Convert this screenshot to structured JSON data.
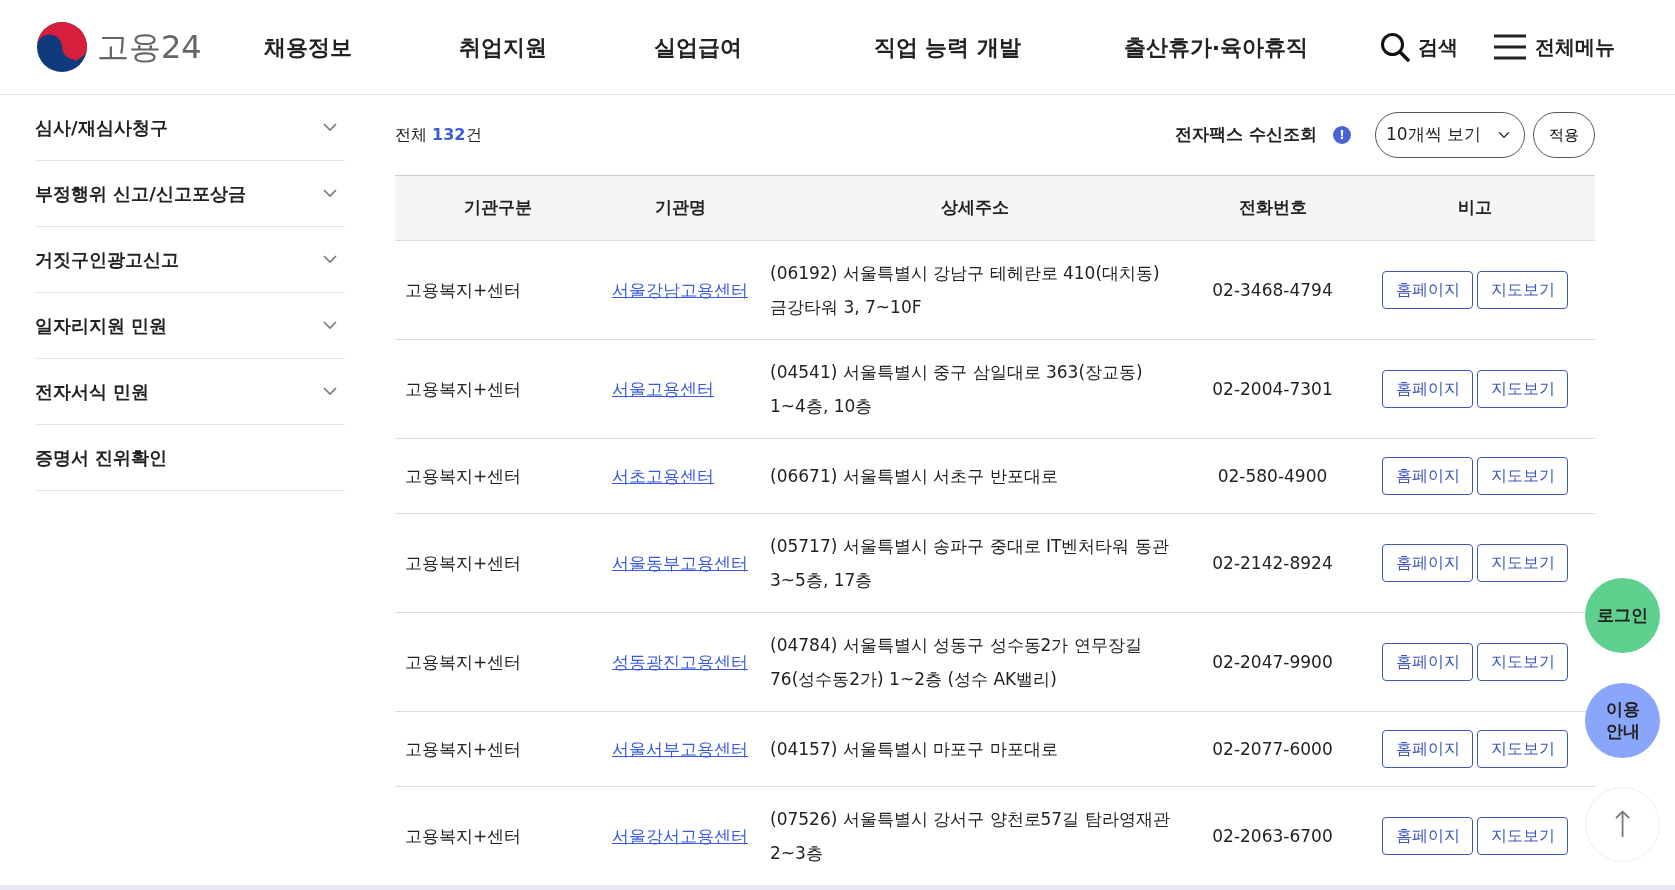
{
  "header": {
    "logo_text": "고용24",
    "nav": [
      "채용정보",
      "취업지원",
      "실업급여",
      "직업 능력 개발",
      "출산휴가·육아휴직"
    ],
    "search_label": "검색",
    "menu_label": "전체메뉴"
  },
  "sidebar": {
    "items": [
      {
        "label": "심사/재심사청구",
        "kind": "accordion"
      },
      {
        "label": "부정행위 신고/신고포상금",
        "kind": "accordion"
      },
      {
        "label": "거짓구인광고신고",
        "kind": "accordion"
      },
      {
        "label": "일자리지원 민원",
        "kind": "accordion"
      },
      {
        "label": "전자서식 민원",
        "kind": "accordion"
      },
      {
        "label": "증명서 진위확인",
        "kind": "link"
      }
    ]
  },
  "toolbar": {
    "total_prefix": "전체",
    "total_count": "132",
    "total_suffix": "건",
    "fax_label": "전자팩스 수신조회",
    "fax_info": "!",
    "page_size": "10개씩 보기",
    "apply_button": "적용"
  },
  "table": {
    "columns": [
      "기관구분",
      "기관명",
      "상세주소",
      "전화번호",
      "비고"
    ],
    "rows": [
      {
        "type": "고용복지+센터",
        "name": "서울강남고용센터",
        "address": "(06192) 서울특별시 강남구 테헤란로 410(대치동) 금강타워 3, 7~10F",
        "phone": "02-3468-4794",
        "buttons": [
          "홈페이지",
          "지도보기"
        ]
      },
      {
        "type": "고용복지+센터",
        "name": "서울고용센터",
        "address": "(04541) 서울특별시 중구 삼일대로 363(장교동) 1~4층, 10층",
        "phone": "02-2004-7301",
        "buttons": [
          "홈페이지",
          "지도보기"
        ]
      },
      {
        "type": "고용복지+센터",
        "name": "서초고용센터",
        "address": "(06671) 서울특별시 서초구 반포대로",
        "phone": "02-580-4900",
        "buttons": [
          "홈페이지",
          "지도보기"
        ]
      },
      {
        "type": "고용복지+센터",
        "name": "서울동부고용센터",
        "address": "(05717) 서울특별시 송파구 중대로 IT벤처타워 동관 3~5층, 17층",
        "phone": "02-2142-8924",
        "buttons": [
          "홈페이지",
          "지도보기"
        ]
      },
      {
        "type": "고용복지+센터",
        "name": "성동광진고용센터",
        "address": "(04784) 서울특별시 성동구 성수동2가 연무장길 76(성수동2가) 1~2층 (성수 AK밸리)",
        "phone": "02-2047-9900",
        "buttons": [
          "홈페이지",
          "지도보기"
        ]
      },
      {
        "type": "고용복지+센터",
        "name": "서울서부고용센터",
        "address": "(04157) 서울특별시 마포구 마포대로",
        "phone": "02-2077-6000",
        "buttons": [
          "홈페이지",
          "지도보기"
        ]
      },
      {
        "type": "고용복지+센터",
        "name": "서울강서고용센터",
        "address": "(07526) 서울특별시 강서구 양천로57길 탐라영재관 2~3층",
        "phone": "02-2063-6700",
        "buttons": [
          "홈페이지",
          "지도보기"
        ]
      }
    ]
  },
  "floating": {
    "login": "로그인",
    "guide": "이용 안내",
    "top": "↑"
  }
}
